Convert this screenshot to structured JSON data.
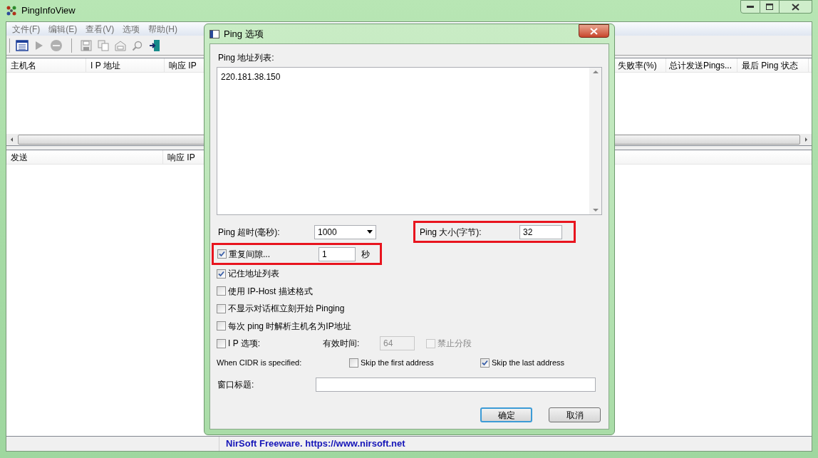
{
  "window": {
    "title": "PingInfoView"
  },
  "menu": [
    "文件(F)",
    "编辑(E)",
    "查看(V)",
    "选项",
    "帮助(H)"
  ],
  "toolbar": [
    {
      "kind": "options",
      "disabled": false
    },
    {
      "kind": "start",
      "disabled": true
    },
    {
      "kind": "stop",
      "disabled": true
    },
    {
      "kind": "separator"
    },
    {
      "kind": "save",
      "disabled": true
    },
    {
      "kind": "copy",
      "disabled": true
    },
    {
      "kind": "properties",
      "disabled": true
    },
    {
      "kind": "find",
      "disabled": true
    },
    {
      "kind": "exit",
      "disabled": false
    }
  ],
  "upper_table": {
    "columns": [
      "主机名",
      "I P 地址",
      "响应 IP",
      "失败率(%)",
      "总计发送Pings...",
      "最后 Ping 状态"
    ]
  },
  "lower_table": {
    "columns": [
      "发送",
      "响应 IP"
    ]
  },
  "status_bar": {
    "text": "NirSoft Freeware. https://www.nirsoft.net"
  },
  "dialog": {
    "title": "Ping 选项",
    "address_list": {
      "label": "Ping 地址列表:",
      "value": "220.181.38.150"
    },
    "timeout": {
      "label": "Ping 超时(毫秒):",
      "value": "1000"
    },
    "size": {
      "label": "Ping 大小(字节):",
      "value": "32",
      "highlighted": true
    },
    "interval": {
      "label": "重复间隙...",
      "checked": true,
      "value": "1",
      "unit": "秒",
      "highlighted": true
    },
    "options": [
      {
        "label": "记住地址列表",
        "checked": true
      },
      {
        "label": "使用 IP-Host 描述格式",
        "checked": false
      },
      {
        "label": "不显示对话框立刻开始 Pinging",
        "checked": false
      },
      {
        "label": "每次 ping 时解析主机名为IP地址",
        "checked": false
      }
    ],
    "ip_options": {
      "label": "I P 选项:",
      "checked": false
    },
    "ttl": {
      "label": "有效时间:",
      "value": "64",
      "disabled": true
    },
    "dont_fragment": {
      "label": "禁止分段",
      "checked": false,
      "disabled": true
    },
    "cidr": {
      "label": "When CIDR is specified:",
      "options": [
        {
          "label": "Skip the first address",
          "checked": false
        },
        {
          "label": "Skip the last address",
          "checked": true
        }
      ]
    },
    "window_title": {
      "label": "窗口标题:"
    },
    "buttons": [
      {
        "label": "确定",
        "default": true
      },
      {
        "label": "取消",
        "default": false
      }
    ]
  }
}
